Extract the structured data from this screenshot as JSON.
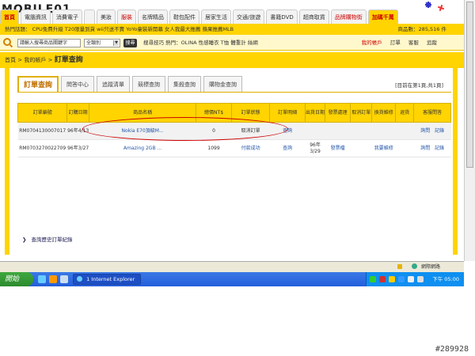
{
  "site": {
    "logo": "MOBILE01",
    "nav_tabs": [
      "首頁",
      "電腦資訊",
      "消費電子",
      "",
      "美妝",
      "服裝",
      "名牌精品",
      "鞋包配件",
      "居家生活",
      "交通/旅遊",
      "書籍DVD",
      "超商取貨",
      "品牌購物街",
      "加碼千萬"
    ]
  },
  "subnav": {
    "text": "熱門話題： CPU免費升級  T20限量到貨  wii只送不賣  YoYo童裝新開幕  女人我最大推薦  蘋果推薦MLB",
    "count": "商品數：285,516 件"
  },
  "search": {
    "placeholder": "請輸入搜尋商品關鍵字",
    "category": "全類別",
    "button": "搜尋",
    "tips": "搜尋技巧 熱門：OLINA 性感睡衣 T恤 體重計 絲網",
    "links": [
      "我的帳戶",
      "訂單",
      "客服",
      "追蹤"
    ]
  },
  "breadcrumb": {
    "home": "首頁",
    "sep": ">",
    "account": "我的帳戶",
    "current": "訂單查詢"
  },
  "tabs": [
    "訂單查詢",
    "問答中心",
    "追蹤清單",
    "競標查詢",
    "集殺查詢",
    "購物金查詢"
  ],
  "page_info": "[目前在第1頁,共1頁]",
  "table": {
    "headers": [
      "訂單編號",
      "訂購日期",
      "商品名稱",
      "總價NT$",
      "訂單狀態",
      "訂單明細",
      "出貨日期",
      "發票處理",
      "取消訂單",
      "換貨維修",
      "退貨",
      "客服問答"
    ],
    "rows": [
      {
        "order_no": "RM0704130007017",
        "date": "96年4/13",
        "product": "Nokia E70頂級M...",
        "total": "0",
        "status": "取消訂單",
        "detail": "查詢",
        "ship_date": "",
        "invoice": "",
        "cancel": "",
        "exchange": "",
        "return": "",
        "ask": "詢問",
        "record": "記錄"
      },
      {
        "order_no": "RM0703270022709",
        "date": "96年3/27",
        "product": "Amazing 2GB ...",
        "total": "1099",
        "status": "付款成功",
        "detail": "查詢",
        "ship_date": "96年3/29",
        "invoice": "發票檔",
        "cancel": "",
        "exchange": "我要維修",
        "return": "",
        "ask": "詢問",
        "record": "記錄"
      }
    ]
  },
  "history_link": "查詢歷史訂單紀錄",
  "statusbar": {
    "zone": "網際網路"
  },
  "taskbar": {
    "start": "開始",
    "task": "1 Internet Explorer",
    "clock": "下午 05:00"
  },
  "watermark": "#289928",
  "colors": {
    "accent": "#ffd400",
    "highlight_oval": "#cc0000",
    "taskbar": "#245edb"
  }
}
